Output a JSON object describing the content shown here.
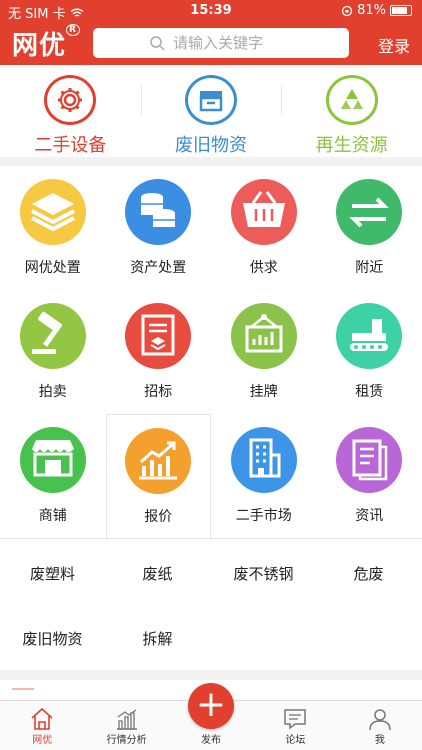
{
  "status": {
    "carrier": "无 SIM 卡",
    "time": "15:39",
    "battery": "81%",
    "battery_level": 0.81
  },
  "header": {
    "logo": "网优",
    "search_placeholder": "请输入关键字",
    "login": "登录"
  },
  "categories": [
    {
      "label": "二手设备",
      "color": "#e0402d",
      "icon": "gear-icon"
    },
    {
      "label": "废旧物资",
      "color": "#3a8fd0",
      "icon": "storage-box-icon"
    },
    {
      "label": "再生资源",
      "color": "#8cc43a",
      "icon": "recycle-icon"
    }
  ],
  "services": [
    {
      "label": "网优处置",
      "color": "#f7c842",
      "icon": "layers-icon"
    },
    {
      "label": "资产处置",
      "color": "#3a8fe3",
      "icon": "coins-icon"
    },
    {
      "label": "供求",
      "color": "#ee5c5a",
      "icon": "basket-icon"
    },
    {
      "label": "附近",
      "color": "#3fba6b",
      "icon": "exchange-arrows-icon"
    },
    {
      "label": "拍卖",
      "color": "#93c642",
      "icon": "gavel-icon"
    },
    {
      "label": "招标",
      "color": "#e84b3f",
      "icon": "tender-document-icon"
    },
    {
      "label": "挂牌",
      "color": "#8bc34a",
      "icon": "listing-board-icon"
    },
    {
      "label": "租赁",
      "color": "#3fd1a6",
      "icon": "excavator-icon"
    },
    {
      "label": "商铺",
      "color": "#47c24d",
      "icon": "shop-icon"
    },
    {
      "label": "报价",
      "color": "#f4a02f",
      "icon": "trend-chart-icon"
    },
    {
      "label": "二手市场",
      "color": "#3d95e8",
      "icon": "building-icon"
    },
    {
      "label": "资讯",
      "color": "#b967d6",
      "icon": "news-document-icon"
    }
  ],
  "tags": [
    "废塑料",
    "废纸",
    "废不锈钢",
    "危废",
    "废旧物资",
    "拆解"
  ],
  "tabbar": {
    "home": "网优",
    "market": "行情分析",
    "publish": "发布",
    "forum": "论坛",
    "me": "我",
    "publish_symbol": "+"
  }
}
